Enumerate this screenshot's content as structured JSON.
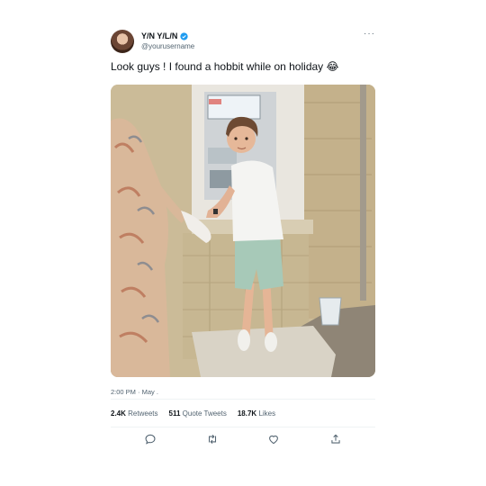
{
  "user": {
    "display_name": "Y/N Y/L/N",
    "handle": "@yourusername",
    "verified": true
  },
  "more_label": "···",
  "tweet": {
    "text": "Look guys ! I found a hobbit while on holiday 😂",
    "meta": "2:00 PM · May ."
  },
  "stats": {
    "retweets_count": "2.4K",
    "retweets_label": "Retweets",
    "quotes_count": "511",
    "quotes_label": "Quote Tweets",
    "likes_count": "18.7K",
    "likes_label": "Likes"
  },
  "icons": {
    "reply": "speech-bubble-icon",
    "retweet": "retweet-arrows-icon",
    "like": "heart-icon",
    "share": "share-upload-icon"
  },
  "colors": {
    "verified": "#1d9bf0",
    "secondary_text": "#536471",
    "primary_text": "#0f1419"
  }
}
